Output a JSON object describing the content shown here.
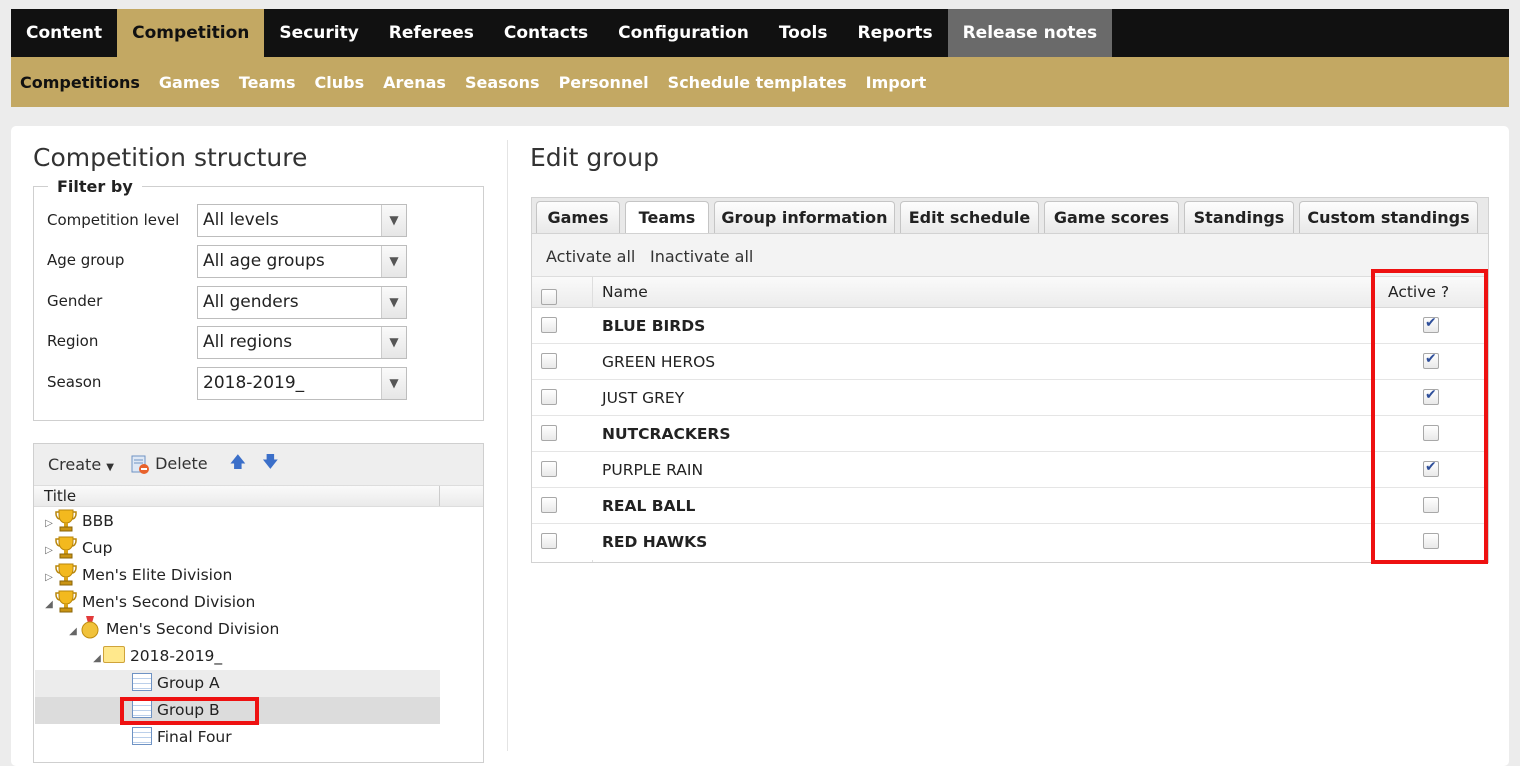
{
  "topnav": [
    "Content",
    "Competition",
    "Security",
    "Referees",
    "Contacts",
    "Configuration",
    "Tools",
    "Reports",
    "Release notes"
  ],
  "subnav": [
    "Competitions",
    "Games",
    "Teams",
    "Clubs",
    "Arenas",
    "Seasons",
    "Personnel",
    "Schedule templates",
    "Import"
  ],
  "left": {
    "title": "Competition structure",
    "filter_legend": "Filter by",
    "filters": [
      {
        "label": "Competition level",
        "value": "All levels"
      },
      {
        "label": "Age group",
        "value": "All age groups"
      },
      {
        "label": "Gender",
        "value": "All genders"
      },
      {
        "label": "Region",
        "value": "All regions"
      },
      {
        "label": "Season",
        "value": "2018-2019_"
      }
    ],
    "toolbar": {
      "create": "Create",
      "delete": "Delete"
    },
    "tree_header": "Title",
    "tree": [
      {
        "label": "BBB",
        "icon": "trophy-icon"
      },
      {
        "label": "Cup",
        "icon": "trophy-icon"
      },
      {
        "label": "Men's Elite Division",
        "icon": "trophy-icon"
      },
      {
        "label": "Men's Second Division",
        "icon": "trophy-icon"
      },
      {
        "label": "Men's Second Division",
        "icon": "medal-icon"
      },
      {
        "label": "2018-2019_",
        "icon": "folder-icon"
      },
      {
        "label": "Group A",
        "icon": "group-icon"
      },
      {
        "label": "Group B",
        "icon": "group-icon"
      },
      {
        "label": "Final Four",
        "icon": "group-icon"
      }
    ]
  },
  "right": {
    "title": "Edit group",
    "tabs": [
      "Games",
      "Teams",
      "Group information",
      "Edit schedule",
      "Game scores",
      "Standings",
      "Custom standings"
    ],
    "active_tab": "Teams",
    "toolbar": {
      "activate": "Activate all",
      "inactivate": "Inactivate all"
    },
    "columns": {
      "name": "Name",
      "active": "Active ?"
    },
    "teams": [
      {
        "name": "BLUE BIRDS",
        "bold": true,
        "active": true
      },
      {
        "name": "GREEN HEROS",
        "bold": false,
        "active": true
      },
      {
        "name": "JUST GREY",
        "bold": false,
        "active": true
      },
      {
        "name": "NUTCRACKERS",
        "bold": true,
        "active": false
      },
      {
        "name": "PURPLE RAIN",
        "bold": false,
        "active": true
      },
      {
        "name": "REAL BALL",
        "bold": true,
        "active": false
      },
      {
        "name": "RED HAWKS",
        "bold": true,
        "active": false
      }
    ]
  },
  "colors": {
    "accent": "#c3a863",
    "nav": "#111111",
    "highlight": "#ee1111"
  }
}
